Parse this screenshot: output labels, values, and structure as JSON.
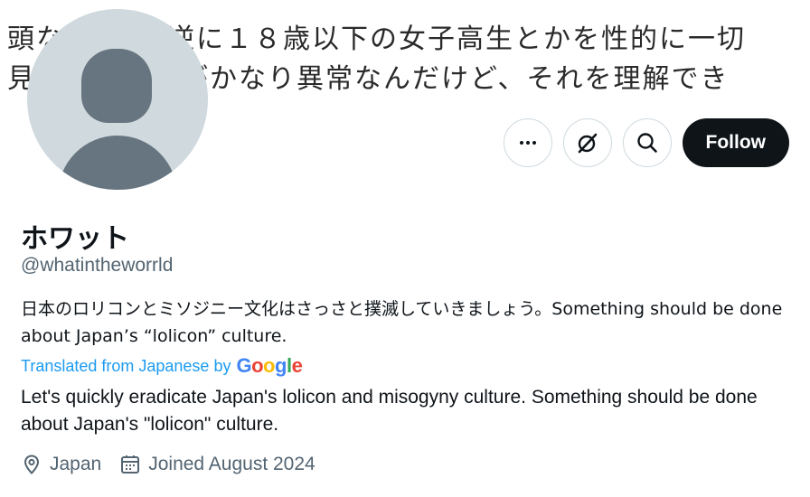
{
  "banner": {
    "lines": [
      "",
      "頭な　　　「逆に１８歳以下の女子高生とかを性的に一切",
      "見　　　　うがかなり異常なんだけど、それを理解でき"
    ]
  },
  "profile": {
    "display_name": "ホワット",
    "handle": "@whatintheworrld",
    "bio": "日本のロリコンとミソジニー文化はさっさと撲滅していきましょう。Something should be done about Japan’s “lolicon” culture.",
    "translated_label": "Translated from Japanese by",
    "translation_provider": "Google",
    "translation": "Let's quickly eradicate Japan's lolicon and misogyny culture. Something should be done about Japan's \"lolicon\" culture.",
    "location": "Japan",
    "joined": "Joined August 2024"
  },
  "actions": {
    "more_icon": "more-horizontal-icon",
    "grok_icon": "grok-icon",
    "search_icon": "search-icon",
    "follow_label": "Follow"
  },
  "colors": {
    "primary_text": "#0f1419",
    "secondary_text": "#536471",
    "link": "#1d9bf0",
    "follow_bg": "#0f1419",
    "avatar_bg": "#cfd9de",
    "avatar_fg": "#66757f"
  }
}
